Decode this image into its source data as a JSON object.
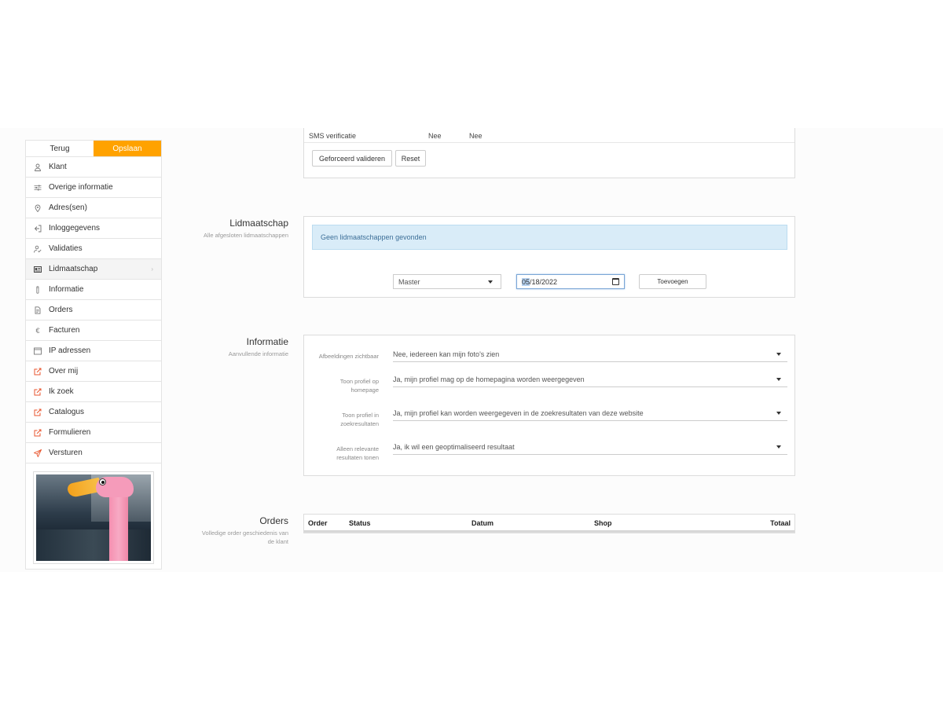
{
  "sidebar": {
    "back_label": "Terug",
    "save_label": "Opslaan",
    "items": [
      {
        "label": "Klant",
        "icon": "user-icon"
      },
      {
        "label": "Overige informatie",
        "icon": "sliders-icon"
      },
      {
        "label": "Adres(sen)",
        "icon": "map-pin-icon"
      },
      {
        "label": "Inloggegevens",
        "icon": "login-icon"
      },
      {
        "label": "Validaties",
        "icon": "user-check-icon"
      },
      {
        "label": "Lidmaatschap",
        "icon": "id-card-icon"
      },
      {
        "label": "Informatie",
        "icon": "info-icon"
      },
      {
        "label": "Orders",
        "icon": "document-icon"
      },
      {
        "label": "Facturen",
        "icon": "euro-icon"
      },
      {
        "label": "IP adressen",
        "icon": "browser-window-icon"
      },
      {
        "label": "Over mij",
        "icon": "external-edit-icon"
      },
      {
        "label": "Ik zoek",
        "icon": "external-edit-icon"
      },
      {
        "label": "Catalogus",
        "icon": "external-edit-icon"
      },
      {
        "label": "Formulieren",
        "icon": "external-edit-icon"
      },
      {
        "label": "Versturen",
        "icon": "send-icon"
      }
    ],
    "active_item": "Lidmaatschap",
    "photo_alt": "flamingo-photo",
    "accent_color": "#ffa200"
  },
  "verification": {
    "row_label": "SMS verificatie",
    "col1": "Nee",
    "col2": "Nee",
    "force_validate_label": "Geforceerd valideren",
    "reset_label": "Reset"
  },
  "membership": {
    "title": "Lidmaatschap",
    "subtitle": "Alle afgesloten lidmaatschappen",
    "empty_message": "Geen lidmaatschappen gevonden",
    "type_selected": "Master",
    "date_month": "05",
    "date_rest": "/18/2022",
    "add_label": "Toevoegen"
  },
  "information": {
    "title": "Informatie",
    "subtitle": "Aanvullende informatie",
    "fields": [
      {
        "label": "Afbeeldingen zichtbaar",
        "value": "Nee, iedereen kan mijn foto's zien"
      },
      {
        "label": "Toon profiel op homepage",
        "value": "Ja, mijn profiel mag op de homepagina worden weergegeven"
      },
      {
        "label": "Toon profiel in zoekresultaten",
        "value": "Ja, mijn profiel kan worden weergegeven in de zoekresultaten van deze website"
      },
      {
        "label": "Alleen relevante resultaten tonen",
        "value": "Ja, ik wil een geoptimaliseerd resultaat"
      }
    ]
  },
  "orders": {
    "title": "Orders",
    "subtitle": "Volledige order geschiedenis van de klant",
    "columns": [
      "Order",
      "Status",
      "Datum",
      "Shop",
      "Totaal"
    ]
  }
}
